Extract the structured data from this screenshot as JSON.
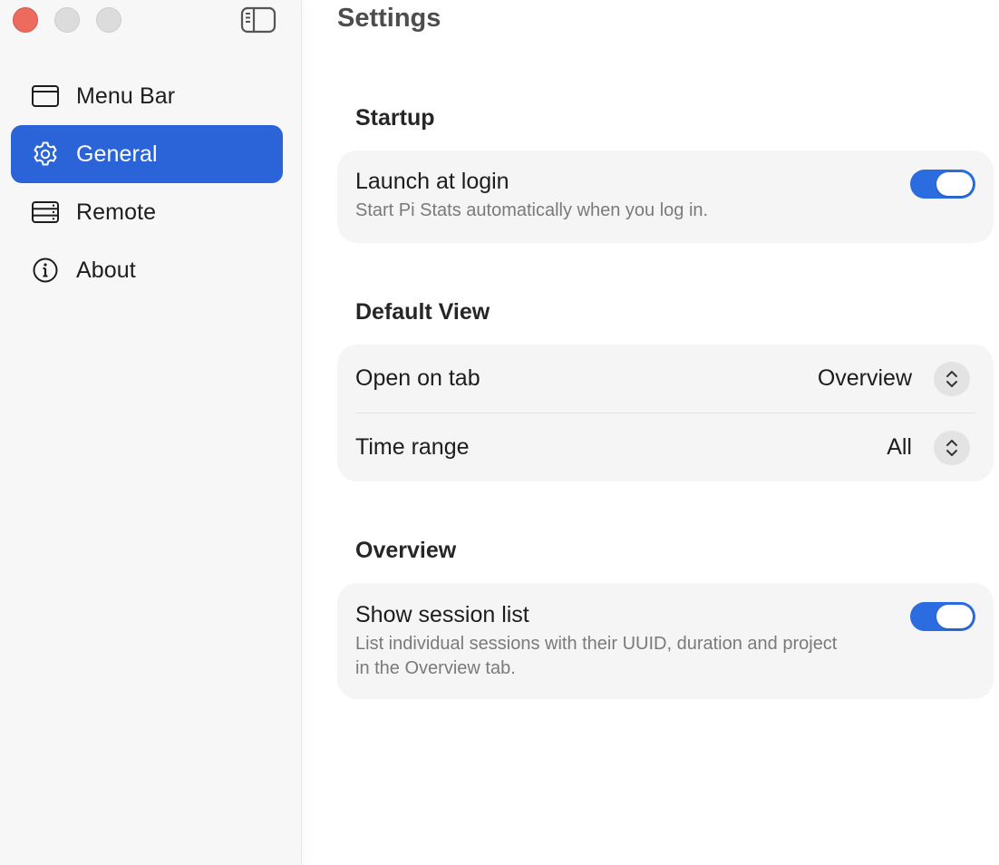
{
  "window": {
    "title": "Settings"
  },
  "sidebar": {
    "items": [
      {
        "label": "Menu Bar",
        "icon": "window-icon",
        "active": false
      },
      {
        "label": "General",
        "icon": "gear-icon",
        "active": true
      },
      {
        "label": "Remote",
        "icon": "server-icon",
        "active": false
      },
      {
        "label": "About",
        "icon": "info-icon",
        "active": false
      }
    ]
  },
  "sections": {
    "startup": {
      "title": "Startup",
      "launch_at_login": {
        "label": "Launch at login",
        "description": "Start Pi Stats automatically when you log in.",
        "enabled": true
      }
    },
    "default_view": {
      "title": "Default View",
      "open_on_tab": {
        "label": "Open on tab",
        "value": "Overview"
      },
      "time_range": {
        "label": "Time range",
        "value": "All"
      }
    },
    "overview": {
      "title": "Overview",
      "show_session_list": {
        "label": "Show session list",
        "description_line1": "List individual sessions with their UUID, duration and project",
        "description_line2": "in the Overview tab.",
        "enabled": true
      }
    }
  },
  "colors": {
    "accent": "#2b64d8",
    "toggle_on": "#2b6de0",
    "close_button": "#ec6a5e"
  }
}
